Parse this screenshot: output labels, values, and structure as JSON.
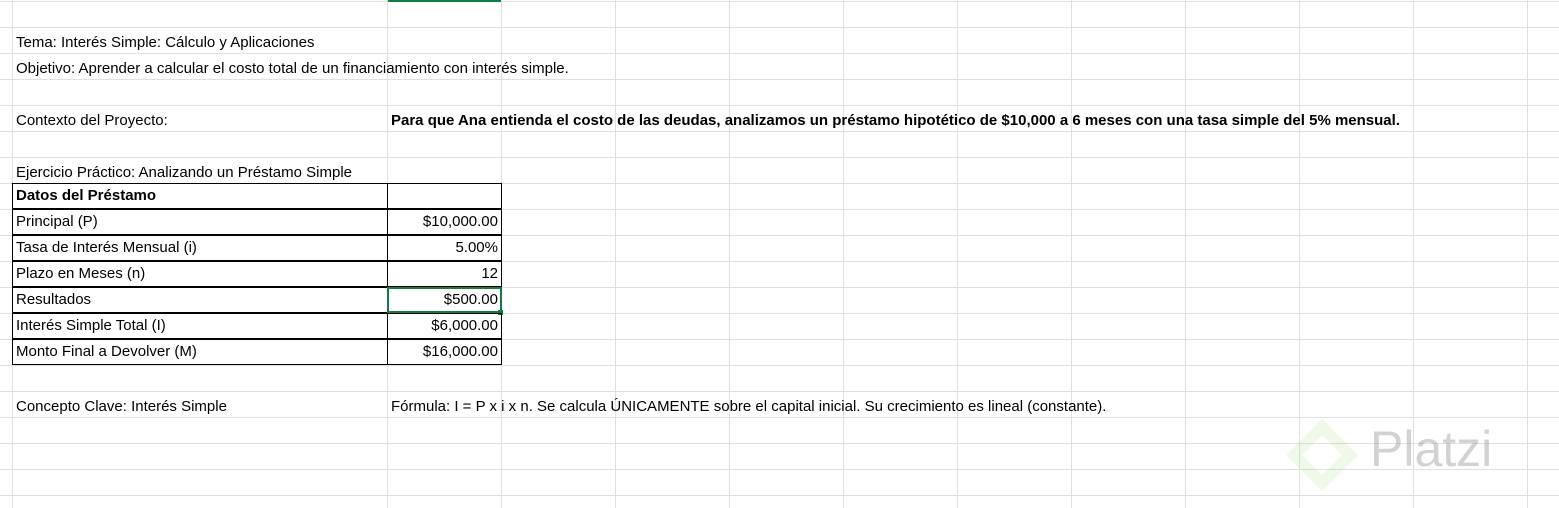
{
  "tema": "Tema: Interés Simple: Cálculo y Aplicaciones",
  "objetivo": "Objetivo: Aprender a calcular el costo total de un financiamiento con interés simple.",
  "contexto": {
    "label": "Contexto del Proyecto:",
    "value": "Para que Ana entienda el costo de las deudas, analizamos un préstamo hipotético de $10,000 a 6 meses con una tasa simple del 5% mensual."
  },
  "ejercicio_title": "Ejercicio Práctico: Analizando un Préstamo Simple",
  "table": {
    "header": "Datos del Préstamo",
    "rows": [
      {
        "label": "Principal (P)",
        "value": "$10,000.00"
      },
      {
        "label": "Tasa de Interés Mensual (i)",
        "value": "5.00%"
      },
      {
        "label": "Plazo en Meses (n)",
        "value": "12"
      },
      {
        "label": "Resultados",
        "value": "$500.00"
      },
      {
        "label": "Interés Simple Total (I)",
        "value": "$6,000.00"
      },
      {
        "label": "Monto Final a Devolver (M)",
        "value": "$16,000.00"
      }
    ]
  },
  "concepto": {
    "label": "Concepto Clave: Interés Simple",
    "value": "Fórmula: I = P x i x n. Se calcula ÚNICAMENTE sobre el capital inicial. Su crecimiento es lineal (constante)."
  },
  "watermark": "Platzi",
  "colors": {
    "gridline": "#dfdfdf",
    "selection": "#107c41"
  }
}
